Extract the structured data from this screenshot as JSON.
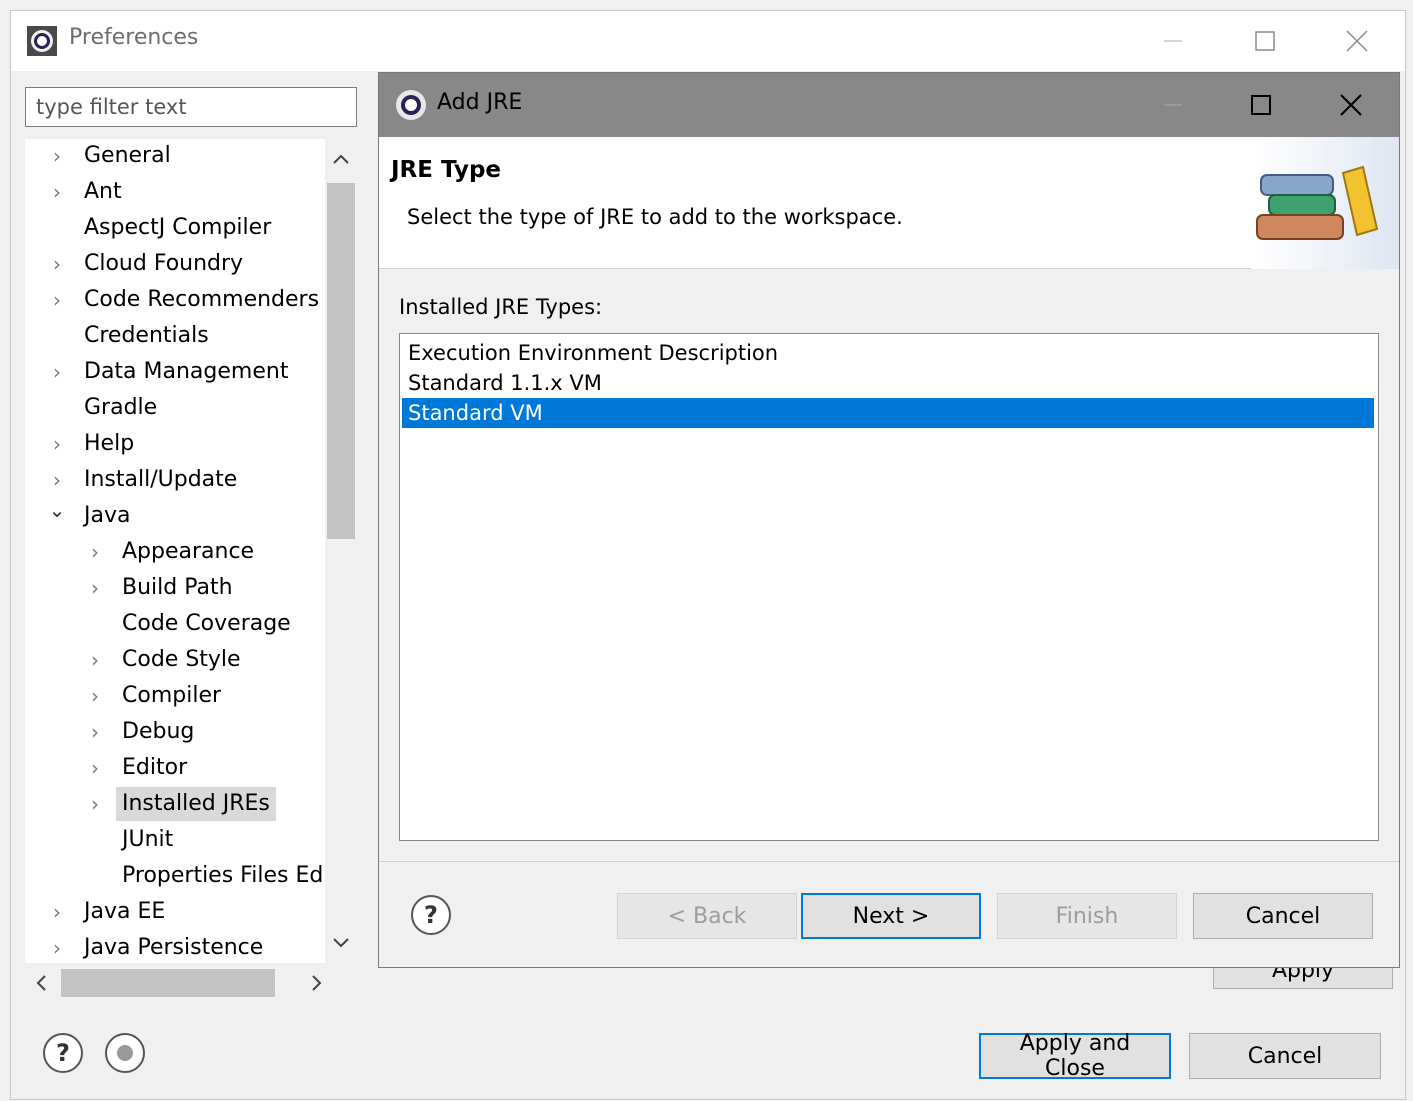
{
  "prefs": {
    "title": "Preferences",
    "filter_placeholder": "type filter text",
    "tree": [
      {
        "label": "General",
        "chevron": "chevron-right-icon",
        "level": 0
      },
      {
        "label": "Ant",
        "chevron": "chevron-right-icon",
        "level": 0
      },
      {
        "label": "AspectJ Compiler",
        "chevron": null,
        "level": 0
      },
      {
        "label": "Cloud Foundry",
        "chevron": "chevron-right-icon",
        "level": 0
      },
      {
        "label": "Code Recommenders",
        "chevron": "chevron-right-icon",
        "level": 0
      },
      {
        "label": "Credentials",
        "chevron": null,
        "level": 0
      },
      {
        "label": "Data Management",
        "chevron": "chevron-right-icon",
        "level": 0
      },
      {
        "label": "Gradle",
        "chevron": null,
        "level": 0
      },
      {
        "label": "Help",
        "chevron": "chevron-right-icon",
        "level": 0
      },
      {
        "label": "Install/Update",
        "chevron": "chevron-right-icon",
        "level": 0
      },
      {
        "label": "Java",
        "chevron": "chevron-down-icon",
        "level": 0
      },
      {
        "label": "Appearance",
        "chevron": "chevron-right-icon",
        "level": 1
      },
      {
        "label": "Build Path",
        "chevron": "chevron-right-icon",
        "level": 1
      },
      {
        "label": "Code Coverage",
        "chevron": null,
        "level": 1
      },
      {
        "label": "Code Style",
        "chevron": "chevron-right-icon",
        "level": 1
      },
      {
        "label": "Compiler",
        "chevron": "chevron-right-icon",
        "level": 1
      },
      {
        "label": "Debug",
        "chevron": "chevron-right-icon",
        "level": 1
      },
      {
        "label": "Editor",
        "chevron": "chevron-right-icon",
        "level": 1
      },
      {
        "label": "Installed JREs",
        "chevron": "chevron-right-icon",
        "level": 1,
        "selected": true
      },
      {
        "label": "JUnit",
        "chevron": null,
        "level": 1
      },
      {
        "label": "Properties Files Editc",
        "chevron": null,
        "level": 1
      },
      {
        "label": "Java EE",
        "chevron": "chevron-right-icon",
        "level": 0
      },
      {
        "label": "Java Persistence",
        "chevron": "chevron-right-icon",
        "level": 0
      }
    ],
    "apply_label": "Apply",
    "apply_close_label": "Apply and Close",
    "cancel_label": "Cancel"
  },
  "dialog": {
    "title": "Add JRE",
    "banner_title": "JRE Type",
    "banner_desc": "Select the type of JRE to add to the workspace.",
    "types_label": "Installed JRE Types:",
    "types": [
      {
        "label": "Execution Environment Description",
        "selected": false
      },
      {
        "label": "Standard 1.1.x VM",
        "selected": false
      },
      {
        "label": "Standard VM",
        "selected": true
      }
    ],
    "back_label": "< Back",
    "next_label": "Next >",
    "finish_label": "Finish",
    "cancel_label": "Cancel"
  },
  "colors": {
    "selection": "#0078d7",
    "dialog_titlebar": "#888888"
  }
}
